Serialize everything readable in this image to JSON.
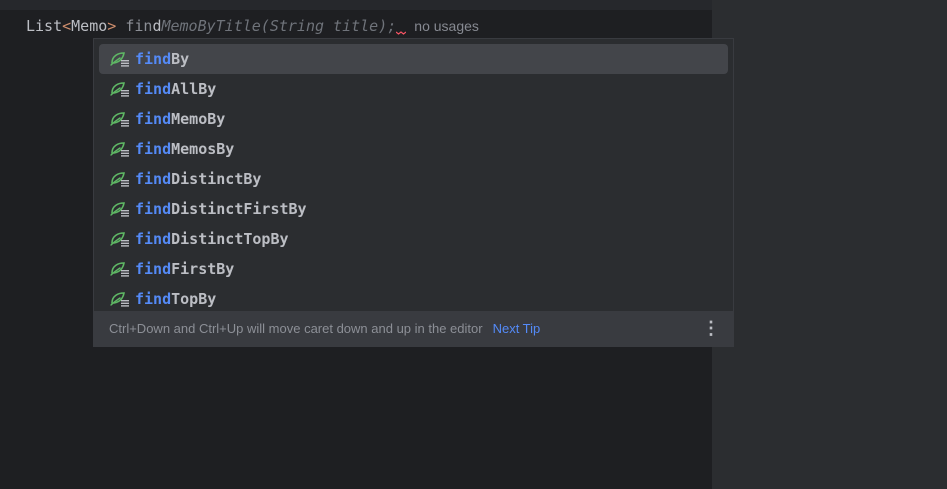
{
  "editor": {
    "code": {
      "type_name": "List",
      "open_angle": "<",
      "generic_type": "Memo",
      "close_angle": ">",
      "typed_prefix": "fin",
      "typed_cursor_char": "d",
      "ghost_completion": "MemoByTitle(String title);",
      "usage_hint": "no usages"
    }
  },
  "completion_popup": {
    "items": [
      {
        "match": "find",
        "rest": "By",
        "icon": "spring-data-method-icon",
        "selected": true
      },
      {
        "match": "find",
        "rest": "AllBy",
        "icon": "spring-data-method-icon",
        "selected": false
      },
      {
        "match": "find",
        "rest": "MemoBy",
        "icon": "spring-data-method-icon",
        "selected": false
      },
      {
        "match": "find",
        "rest": "MemosBy",
        "icon": "spring-data-method-icon",
        "selected": false
      },
      {
        "match": "find",
        "rest": "DistinctBy",
        "icon": "spring-data-method-icon",
        "selected": false
      },
      {
        "match": "find",
        "rest": "DistinctFirstBy",
        "icon": "spring-data-method-icon",
        "selected": false
      },
      {
        "match": "find",
        "rest": "DistinctTopBy",
        "icon": "spring-data-method-icon",
        "selected": false
      },
      {
        "match": "find",
        "rest": "FirstBy",
        "icon": "spring-data-method-icon",
        "selected": false
      },
      {
        "match": "find",
        "rest": "TopBy",
        "icon": "spring-data-method-icon",
        "selected": false
      }
    ],
    "footer": {
      "tip": "Ctrl+Down and Ctrl+Up will move caret down and up in the editor",
      "next_tip": "Next Tip",
      "more_icon": "vertical-ellipsis-icon"
    }
  },
  "colors": {
    "editor_bg": "#1e1f22",
    "popup_bg": "#2b2d30",
    "selection_bg": "#43454a",
    "match_blue": "#548af7",
    "icon_green": "#5fb865"
  }
}
